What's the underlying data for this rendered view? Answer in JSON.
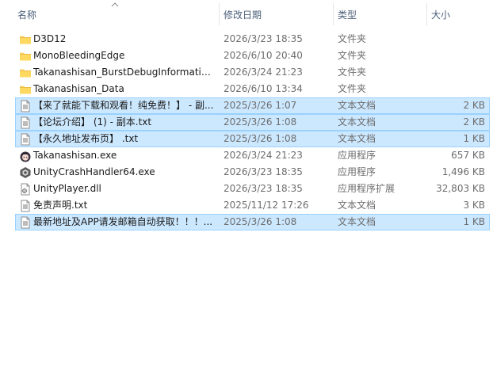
{
  "columns": {
    "name": "名称",
    "date": "修改日期",
    "type": "类型",
    "size": "大小"
  },
  "files": [
    {
      "name": "D3D12",
      "date": "2026/3/23 18:35",
      "type": "文件夹",
      "size": "",
      "icon": "folder-icon",
      "selected": false
    },
    {
      "name": "MonoBleedingEdge",
      "date": "2026/6/10 20:40",
      "type": "文件夹",
      "size": "",
      "icon": "folder-icon",
      "selected": false
    },
    {
      "name": "Takanashisan_BurstDebugInformatio...",
      "date": "2026/3/24 21:23",
      "type": "文件夹",
      "size": "",
      "icon": "folder-icon",
      "selected": false
    },
    {
      "name": "Takanashisan_Data",
      "date": "2026/6/10 13:34",
      "type": "文件夹",
      "size": "",
      "icon": "folder-icon",
      "selected": false
    },
    {
      "name": "【来了就能下载和观看！纯免费！】 - 副...",
      "date": "2025/3/26 1:07",
      "type": "文本文档",
      "size": "2 KB",
      "icon": "text-file-icon",
      "selected": true
    },
    {
      "name": "【论坛介绍】 (1) - 副本.txt",
      "date": "2025/3/26 1:08",
      "type": "文本文档",
      "size": "2 KB",
      "icon": "text-file-icon",
      "selected": true
    },
    {
      "name": "【永久地址发布页】 .txt",
      "date": "2025/3/26 1:08",
      "type": "文本文档",
      "size": "1 KB",
      "icon": "text-file-icon",
      "selected": true
    },
    {
      "name": "Takanashisan.exe",
      "date": "2026/3/24 21:23",
      "type": "应用程序",
      "size": "657 KB",
      "icon": "app-character-icon",
      "selected": false
    },
    {
      "name": "UnityCrashHandler64.exe",
      "date": "2026/3/23 18:35",
      "type": "应用程序",
      "size": "1,496 KB",
      "icon": "unity-icon",
      "selected": false
    },
    {
      "name": "UnityPlayer.dll",
      "date": "2026/3/23 18:35",
      "type": "应用程序扩展",
      "size": "32,803 KB",
      "icon": "dll-icon",
      "selected": false
    },
    {
      "name": "免责声明.txt",
      "date": "2025/11/12 17:26",
      "type": "文本文档",
      "size": "3 KB",
      "icon": "text-file-icon",
      "selected": false
    },
    {
      "name": "最新地址及APP请发邮箱自动获取！！！...",
      "date": "2025/3/26 1:08",
      "type": "文本文档",
      "size": "1 KB",
      "icon": "text-file-icon",
      "selected": true
    }
  ]
}
